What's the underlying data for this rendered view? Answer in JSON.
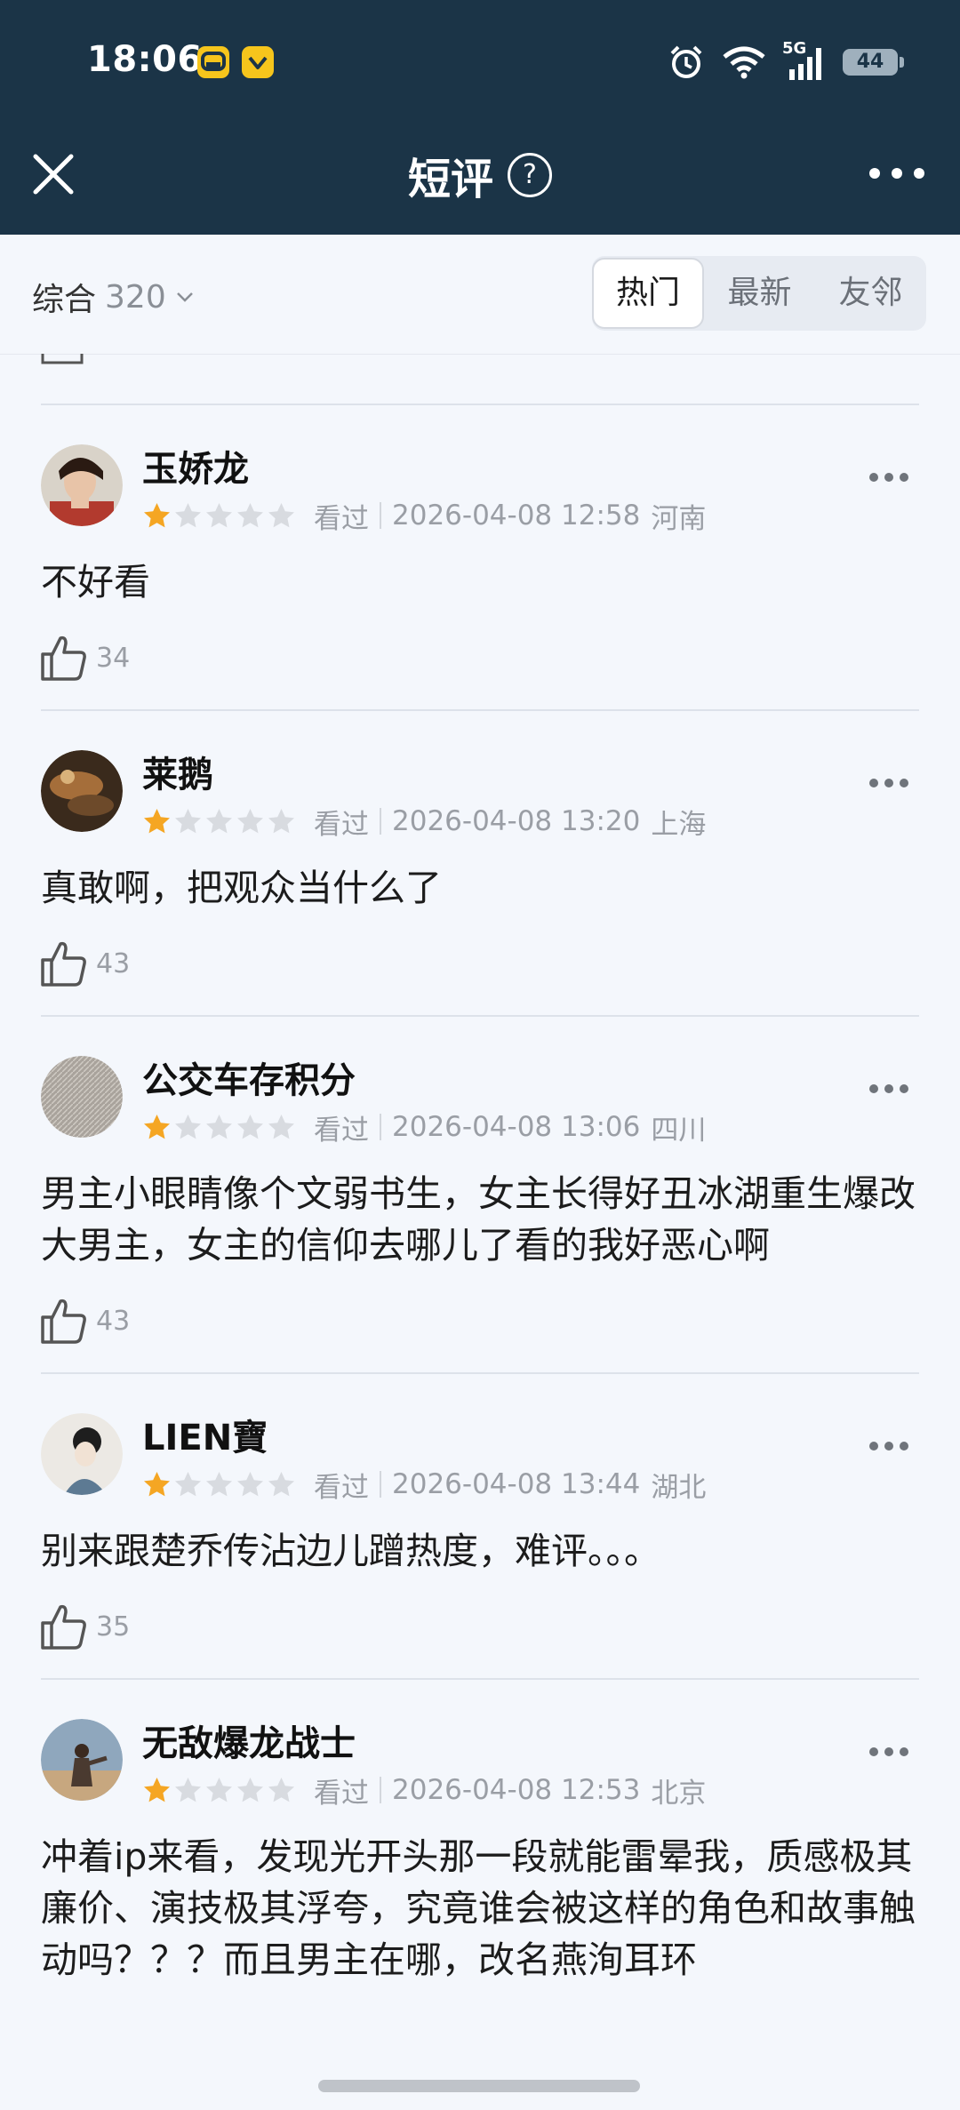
{
  "status_bar": {
    "time": "18:06",
    "network": "5G",
    "battery": "44",
    "icons": [
      "car-app-icon",
      "wallet-app-icon",
      "alarm-icon",
      "wifi-icon",
      "signal-icon",
      "battery-icon"
    ]
  },
  "nav": {
    "title": "短评",
    "help": "?",
    "close_icon": "close-icon",
    "more_icon": "more-icon"
  },
  "filter": {
    "sort_label": "综合",
    "count": "320",
    "tabs": [
      {
        "label": "热门",
        "active": true
      },
      {
        "label": "最新",
        "active": false
      },
      {
        "label": "友邻",
        "active": false
      }
    ]
  },
  "colors": {
    "header_bg": "#1b3447",
    "page_bg": "#f4f7fc",
    "star_filled": "#f5a623",
    "star_empty": "#d8dbe0",
    "meta_text": "#9a9ea5"
  },
  "reviews": [
    {
      "user": "玉娇龙",
      "rating": 1,
      "status": "看过",
      "datetime": "2026-04-08 12:58",
      "location": "河南",
      "text": "不好看",
      "likes": "34"
    },
    {
      "user": "莱鹅",
      "rating": 1,
      "status": "看过",
      "datetime": "2026-04-08 13:20",
      "location": "上海",
      "text": "真敢啊，把观众当什么了",
      "likes": "43"
    },
    {
      "user": "公交车存积分",
      "rating": 1,
      "status": "看过",
      "datetime": "2026-04-08 13:06",
      "location": "四川",
      "text": "男主小眼睛像个文弱书生，女主长得好丑冰湖重生爆改大男主，女主的信仰去哪儿了看的我好恶心啊",
      "likes": "43"
    },
    {
      "user": "LIEN寶",
      "rating": 1,
      "status": "看过",
      "datetime": "2026-04-08 13:44",
      "location": "湖北",
      "text": "别来跟楚乔传沾边儿蹭热度，难评。。。",
      "likes": "35"
    },
    {
      "user": "无敌爆龙战士",
      "rating": 1,
      "status": "看过",
      "datetime": "2026-04-08 12:53",
      "location": "北京",
      "text": "冲着ip来看，发现光开头那一段就能雷晕我，质感极其廉价、演技极其浮夸，究竟谁会被这样的角色和故事触动吗？？？而且男主在哪，改名燕洵耳环",
      "likes": ""
    }
  ]
}
